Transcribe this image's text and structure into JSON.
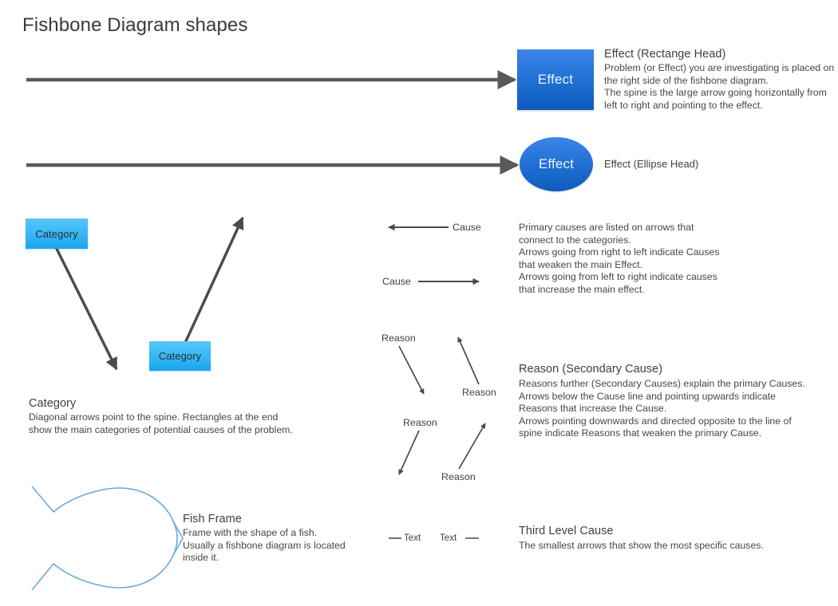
{
  "page": {
    "title": "Fishbone Diagram shapes",
    "background": "#ffffff"
  },
  "colors": {
    "spine": "#595959",
    "arrow": "#4a4a4a",
    "head_blue_light": "#3d85e8",
    "head_blue_dark": "#0f5bbd",
    "category_cyan_light": "#57c7fb",
    "category_cyan_dark": "#16a6ef",
    "fish_outline": "#6aa9e0",
    "heading_text": "#3f3f3f",
    "body_text": "#464646"
  },
  "shapes": {
    "effect_rect_label": "Effect",
    "effect_ellipse_label": "Effect",
    "category_label_1": "Category",
    "category_label_2": "Category"
  },
  "legend": {
    "effect_rect": {
      "heading": "Effect (Rectange Head)",
      "body": "Problem (or Effect) you are investigating is placed on\nthe right side of the fishbone diagram.\nThe spine is the large arrow going horizontally from\nleft to right and pointing to the effect."
    },
    "effect_ellipse": {
      "heading": "Effect (Ellipse Head)"
    },
    "category": {
      "heading": "Category",
      "body": "Diagonal arrows point to the spine. Rectangles at the end\nshow the main categories of potential causes of the problem."
    },
    "cause": {
      "body": "Primary causes are listed on arrows that\nconnect to the categories.\nArrows going from right to left indicate Causes\nthat weaken the main Effect.\nArrows going from left to right indicate causes\nthat increase the main effect."
    },
    "reason": {
      "heading": "Reason (Secondary Cause)",
      "body": "Reasons further (Secondary Causes) explain the primary Causes.\nArrows below the Cause line and pointing upwards indicate\nReasons that increase the Cause.\nArrows pointing downwards and directed opposite to the line of\nspine indicate Reasons that weaken the primary Cause."
    },
    "fish_frame": {
      "heading": "Fish Frame",
      "body": "Frame with the shape of a fish.\nUsually a fishbone diagram is located\ninside it."
    },
    "third_level_cause": {
      "heading": "Third Level Cause",
      "body": "The smallest arrows that show the most specific causes."
    }
  },
  "arrow_labels": {
    "cause_right_to_left": "Cause",
    "cause_left_to_right": "Cause",
    "reason_down_1": "Reason",
    "reason_up_1": "Reason",
    "reason_down_2": "Reason",
    "reason_up_2": "Reason",
    "third_text_1": "Text",
    "third_text_2": "Text"
  }
}
